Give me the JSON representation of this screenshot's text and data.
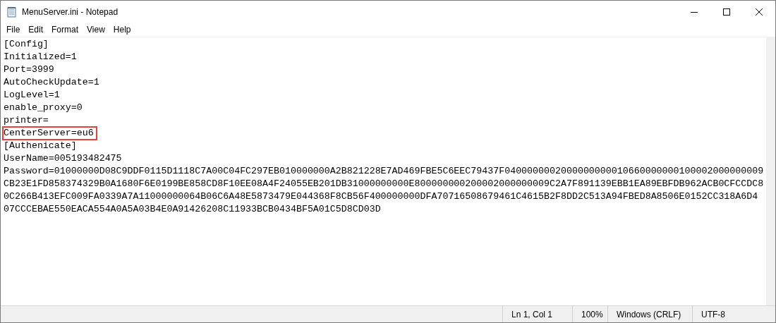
{
  "window": {
    "title": "MenuServer.ini - Notepad"
  },
  "menu": [
    "File",
    "Edit",
    "Format",
    "View",
    "Help"
  ],
  "editor": {
    "rows": [
      {
        "text": "[Config]",
        "highlighted": false
      },
      {
        "text": "Initialized=1",
        "highlighted": false
      },
      {
        "text": "Port=3999",
        "highlighted": false
      },
      {
        "text": "AutoCheckUpdate=1",
        "highlighted": false
      },
      {
        "text": "LogLevel=1",
        "highlighted": false
      },
      {
        "text": "enable_proxy=0",
        "highlighted": false
      },
      {
        "text": "printer=",
        "highlighted": false
      },
      {
        "text": "CenterServer=eu6",
        "highlighted": true
      },
      {
        "text": "[Authenicate]",
        "highlighted": false
      },
      {
        "text": "UserName=005193482475",
        "highlighted": false
      },
      {
        "text": "Password=01000000D08C9DDF0115D1118C7A00C04FC297EB010000000A2B821228E7AD469FBE5C6EEC79437F0400000002000000000010660000000100002000000009",
        "highlighted": false
      },
      {
        "text": "CB23E1FD858374329B0A1680F6E0199BE858CD8F10EE08A4F24055EB201DB31000000000E800000000200002000000009C2A7F891139EBB1EA89EBFDB962ACB0CFCCDC8",
        "highlighted": false
      },
      {
        "text": "0C266B413EFC009FA0339A7A11000000064B06C6A48E5873479E044368F8CB56F400000000DFA70716508679461C4615B2F8DD2C513A94FBED8A8506E0152CC318A6D4",
        "highlighted": false
      },
      {
        "text": "07CCCEBAE550EACA554A0A5A03B4E0A91426208C11933BCB0434BF5A01C5D8CD03D",
        "highlighted": false
      }
    ]
  },
  "status_bar": {
    "position": "Ln 1, Col 1",
    "zoom": "100%",
    "line_endings": "Windows (CRLF)",
    "encoding": "UTF-8"
  }
}
